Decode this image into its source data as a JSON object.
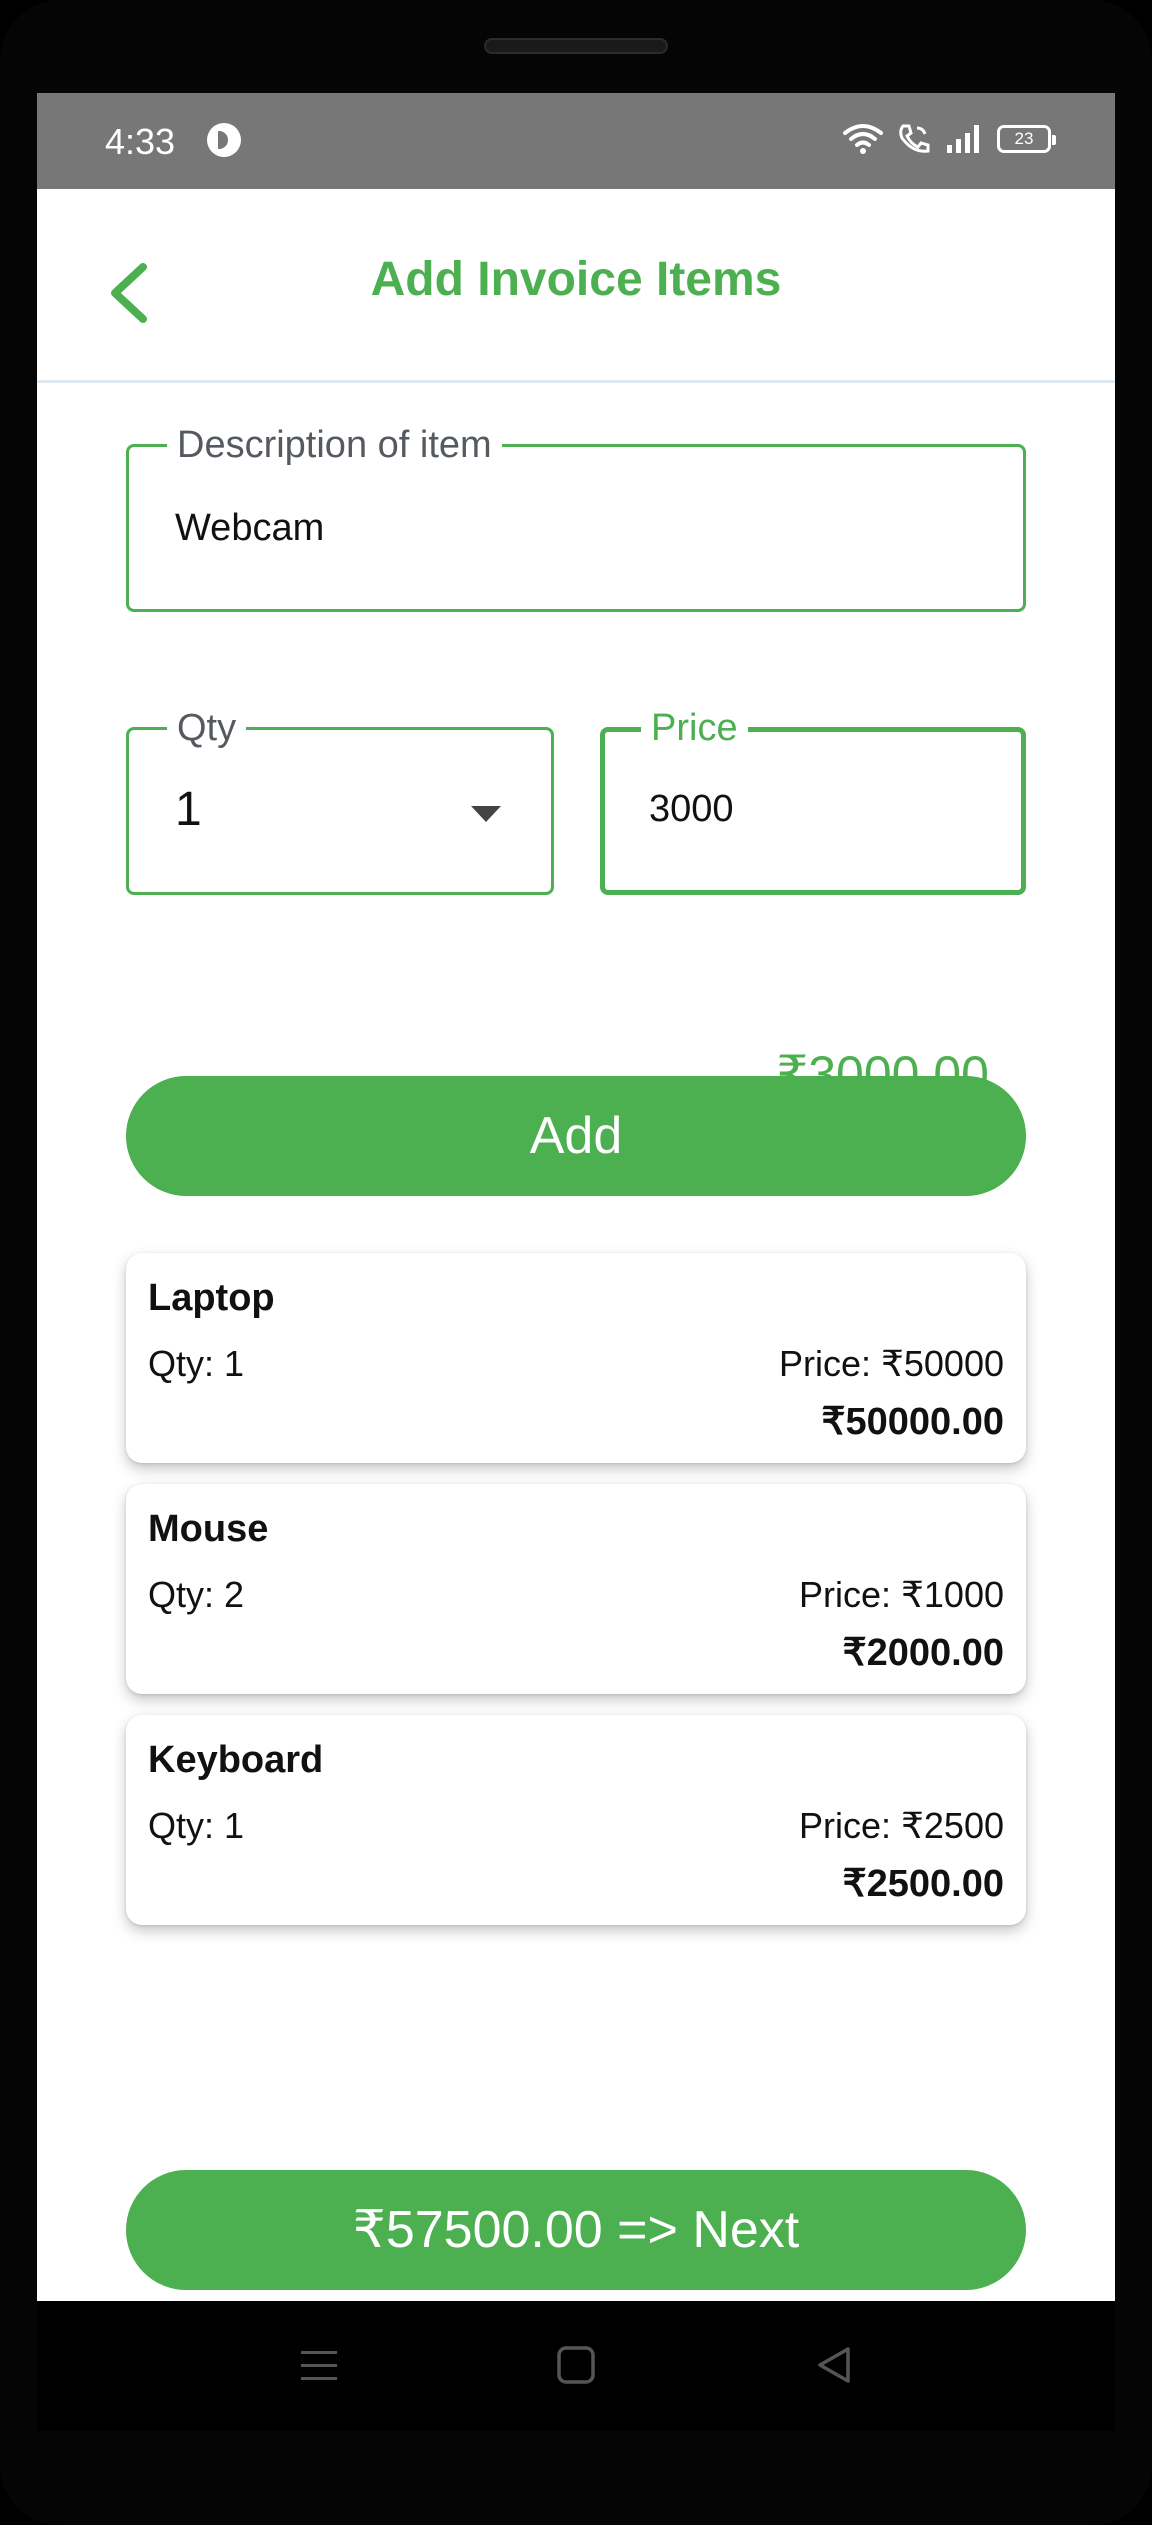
{
  "status_bar": {
    "time": "4:33",
    "battery": "23"
  },
  "app_bar": {
    "title": "Add Invoice Items",
    "back_icon": "chevron-left-icon"
  },
  "form": {
    "description": {
      "label": "Description of item",
      "value": "Webcam"
    },
    "qty": {
      "label": "Qty",
      "value": "1",
      "icon": "dropdown-arrow-icon"
    },
    "price": {
      "label": "Price",
      "value": "3000"
    },
    "line_total": "₹3000.00",
    "add_label": "Add"
  },
  "items": [
    {
      "name": "Laptop",
      "qty": "Qty: 1",
      "price": "Price: ₹50000",
      "total": "₹50000.00"
    },
    {
      "name": "Mouse",
      "qty": "Qty: 2",
      "price": "Price: ₹1000",
      "total": "₹2000.00"
    },
    {
      "name": "Keyboard",
      "qty": "Qty: 1",
      "price": "Price: ₹2500",
      "total": "₹2500.00"
    }
  ],
  "next_button": {
    "label": "₹57500.00 => Next"
  },
  "colors": {
    "accent": "#4caf50",
    "status_bar": "#777777"
  }
}
